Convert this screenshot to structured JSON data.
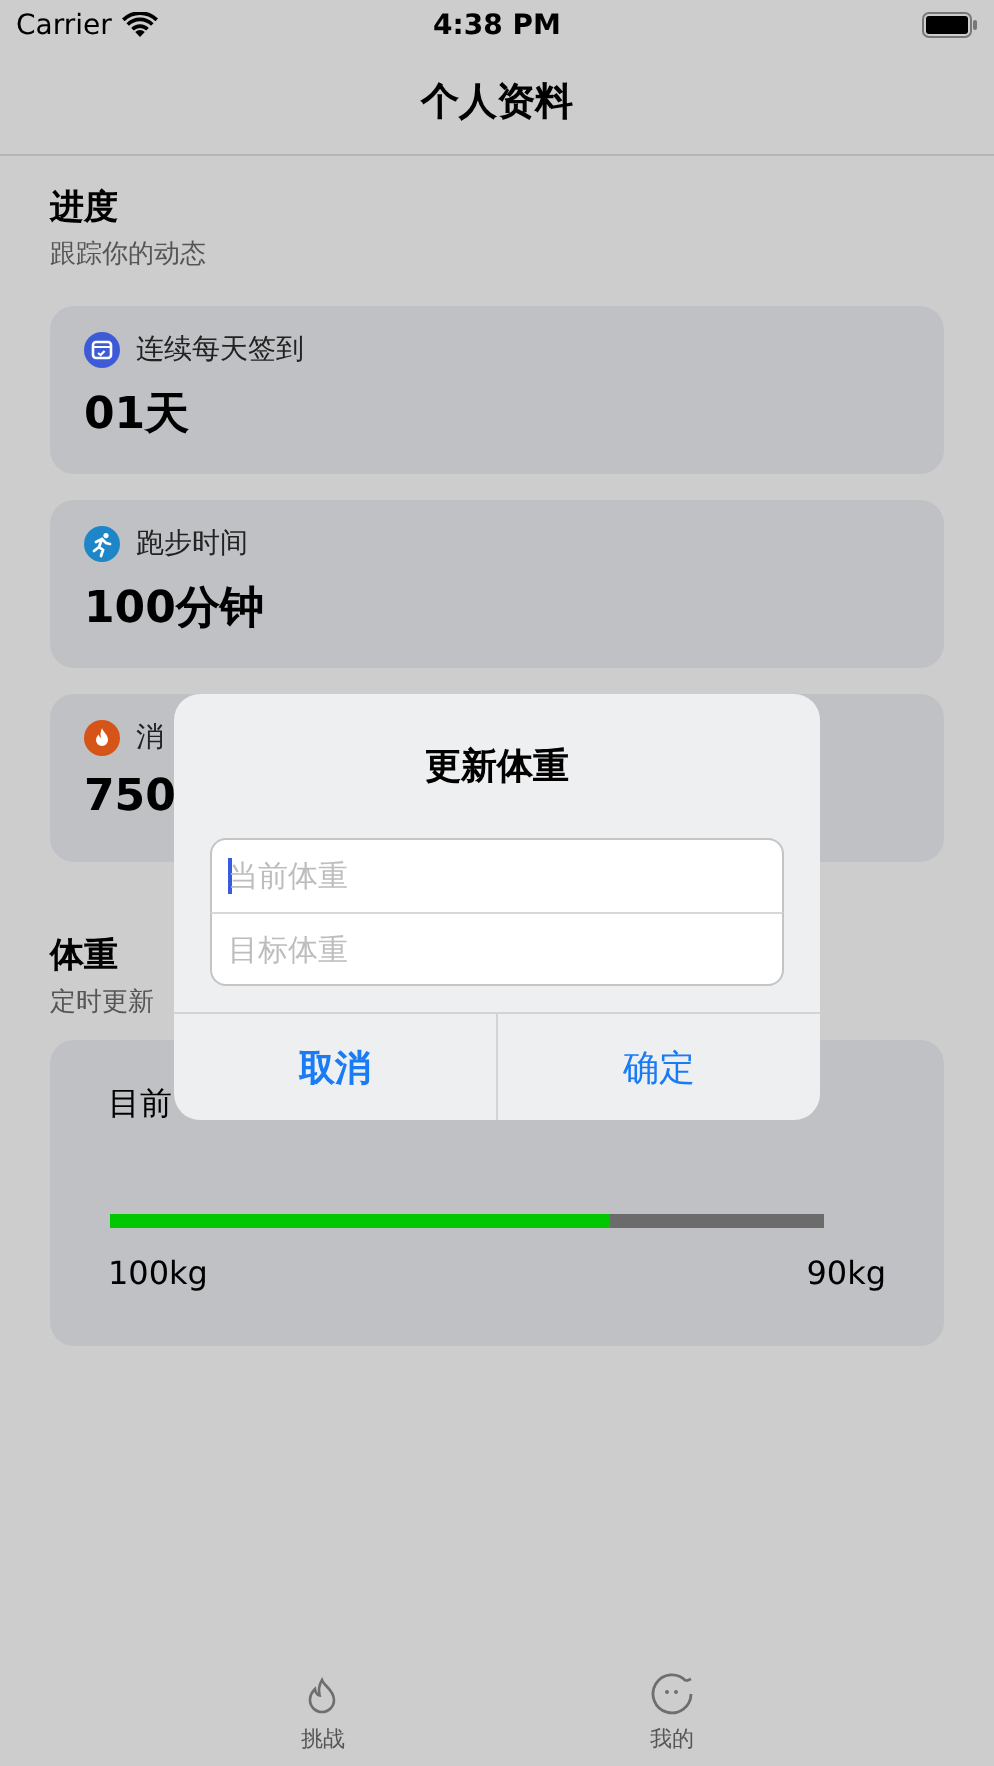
{
  "status_bar": {
    "carrier": "Carrier",
    "time": "4:38 PM"
  },
  "nav": {
    "title": "个人资料"
  },
  "progress": {
    "title": "进度",
    "subtitle": "跟踪你的动态",
    "cards": [
      {
        "kind": "calendar",
        "label": "连续每天签到",
        "value": "01天"
      },
      {
        "kind": "run",
        "label": "跑步时间",
        "value": "100分钟"
      },
      {
        "kind": "flame",
        "label": "消",
        "value": "750"
      }
    ]
  },
  "weight": {
    "title": "体重",
    "subtitle": "定时更新",
    "current_label": "目前",
    "level": 0.7,
    "start": "100kg",
    "target": "90kg"
  },
  "dialog": {
    "title": "更新体重",
    "fields": [
      {
        "placeholder": "当前体重",
        "focused": true
      },
      {
        "placeholder": "目标体重",
        "focused": false
      }
    ],
    "buttons": [
      "取消",
      "确定"
    ]
  },
  "tab_bar": [
    {
      "kind": "flame",
      "label": "挑战"
    },
    {
      "kind": "face",
      "label": "我的"
    }
  ]
}
